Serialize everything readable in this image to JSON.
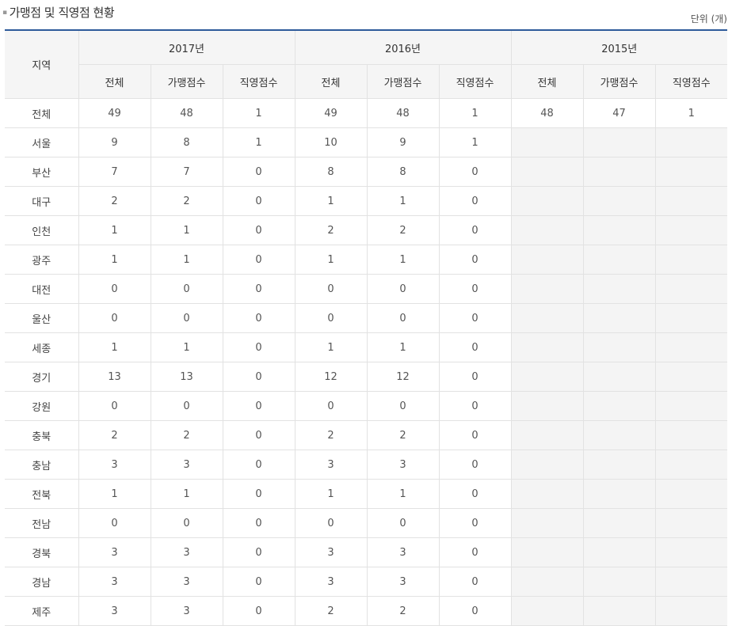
{
  "header": {
    "title": "가맹점 및 직영점 현황",
    "unit": "단위 (개)"
  },
  "table": {
    "region_header": "지역",
    "years": [
      "2017년",
      "2016년",
      "2015년"
    ],
    "sub_headers": [
      "전체",
      "가맹점수",
      "직영점수"
    ],
    "rows": [
      {
        "region": "전체",
        "values": [
          "49",
          "48",
          "1",
          "49",
          "48",
          "1",
          "48",
          "47",
          "1"
        ]
      },
      {
        "region": "서울",
        "values": [
          "9",
          "8",
          "1",
          "10",
          "9",
          "1",
          "",
          "",
          ""
        ]
      },
      {
        "region": "부산",
        "values": [
          "7",
          "7",
          "0",
          "8",
          "8",
          "0",
          "",
          "",
          ""
        ]
      },
      {
        "region": "대구",
        "values": [
          "2",
          "2",
          "0",
          "1",
          "1",
          "0",
          "",
          "",
          ""
        ]
      },
      {
        "region": "인천",
        "values": [
          "1",
          "1",
          "0",
          "2",
          "2",
          "0",
          "",
          "",
          ""
        ]
      },
      {
        "region": "광주",
        "values": [
          "1",
          "1",
          "0",
          "1",
          "1",
          "0",
          "",
          "",
          ""
        ]
      },
      {
        "region": "대전",
        "values": [
          "0",
          "0",
          "0",
          "0",
          "0",
          "0",
          "",
          "",
          ""
        ]
      },
      {
        "region": "울산",
        "values": [
          "0",
          "0",
          "0",
          "0",
          "0",
          "0",
          "",
          "",
          ""
        ]
      },
      {
        "region": "세종",
        "values": [
          "1",
          "1",
          "0",
          "1",
          "1",
          "0",
          "",
          "",
          ""
        ]
      },
      {
        "region": "경기",
        "values": [
          "13",
          "13",
          "0",
          "12",
          "12",
          "0",
          "",
          "",
          ""
        ]
      },
      {
        "region": "강원",
        "values": [
          "0",
          "0",
          "0",
          "0",
          "0",
          "0",
          "",
          "",
          ""
        ]
      },
      {
        "region": "충북",
        "values": [
          "2",
          "2",
          "0",
          "2",
          "2",
          "0",
          "",
          "",
          ""
        ]
      },
      {
        "region": "충남",
        "values": [
          "3",
          "3",
          "0",
          "3",
          "3",
          "0",
          "",
          "",
          ""
        ]
      },
      {
        "region": "전북",
        "values": [
          "1",
          "1",
          "0",
          "1",
          "1",
          "0",
          "",
          "",
          ""
        ]
      },
      {
        "region": "전남",
        "values": [
          "0",
          "0",
          "0",
          "0",
          "0",
          "0",
          "",
          "",
          ""
        ]
      },
      {
        "region": "경북",
        "values": [
          "3",
          "3",
          "0",
          "3",
          "3",
          "0",
          "",
          "",
          ""
        ]
      },
      {
        "region": "경남",
        "values": [
          "3",
          "3",
          "0",
          "3",
          "3",
          "0",
          "",
          "",
          ""
        ]
      },
      {
        "region": "제주",
        "values": [
          "3",
          "3",
          "0",
          "2",
          "2",
          "0",
          "",
          "",
          ""
        ]
      }
    ]
  },
  "colors": {
    "accent_border": "#2d5a9a",
    "header_bg": "#f5f5f5",
    "empty_cell_bg": "#f4f4f4"
  }
}
